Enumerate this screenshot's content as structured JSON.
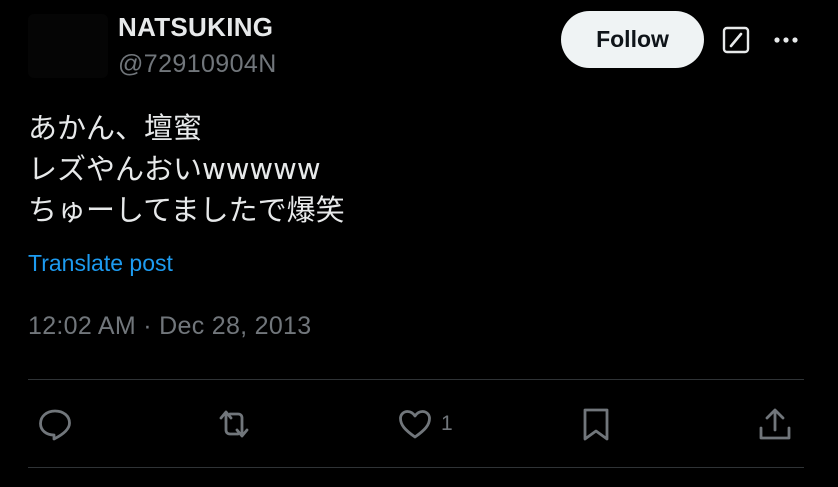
{
  "author": {
    "name": "NATSUKING",
    "handle": "@72910904N"
  },
  "header": {
    "follow_label": "Follow",
    "icons": [
      "grok-icon",
      "more-icon"
    ]
  },
  "tweet": {
    "lines": [
      "あかん、壇蜜",
      "レズやんおいwwwww",
      "ちゅーしてましたで爆笑"
    ],
    "translate_label": "Translate post",
    "timestamp": "12:02 AM · Dec 28, 2013"
  },
  "actions": {
    "like_count": "1",
    "icons": [
      "reply-icon",
      "retweet-icon",
      "like-icon",
      "bookmark-icon",
      "share-icon"
    ]
  },
  "colors": {
    "background": "#000000",
    "text": "#e7e9ea",
    "muted": "#71767b",
    "link": "#1d9bf0",
    "divider": "#2f3336",
    "button_bg": "#eff3f4"
  }
}
